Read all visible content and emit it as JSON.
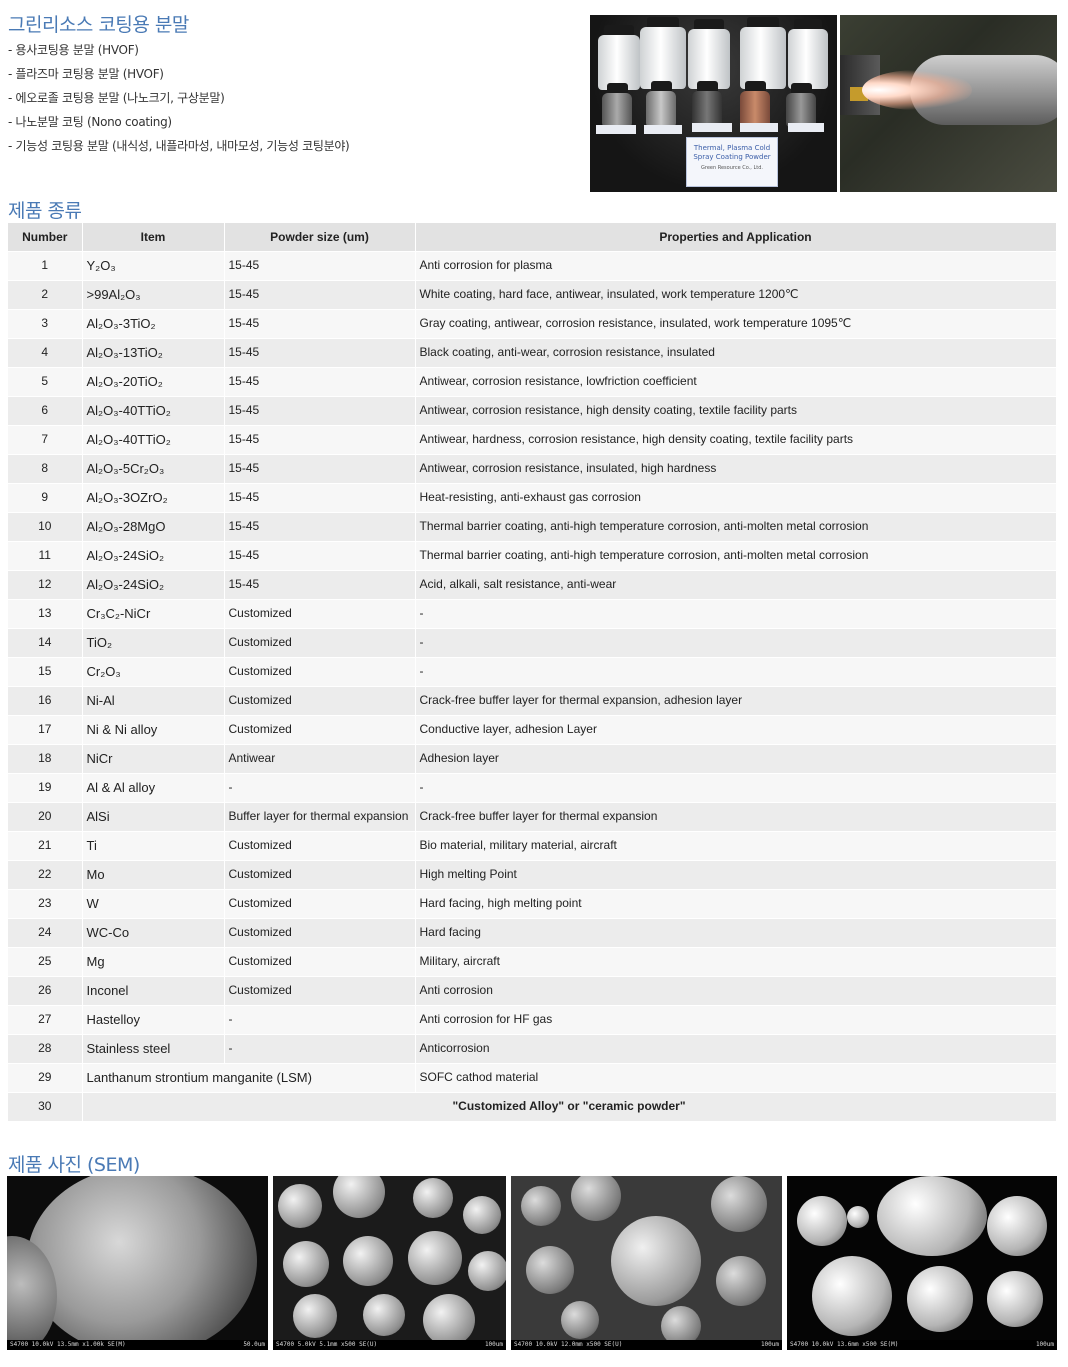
{
  "intro": {
    "title": "그린리소스 코팅용 분말",
    "items": [
      "- 용사코팅용 분말 (HVOF)",
      "- 플라즈마 코팅용 분말 (HVOF)",
      "- 에오로졸 코팅용 분말 (나노크기, 구상분말)",
      "- 나노분말 코팅 (Nono coating)",
      "- 기능성 코팅용 분말 (내식성, 내플라마성, 내마모성, 기능성 코팅분야)"
    ],
    "photo_label": "Thermal, Plasma Cold Spray Coating Powder",
    "photo_company": "Green Resource Co., Ltd."
  },
  "products": {
    "title": "제품 종류",
    "headers": [
      "Number",
      "Item",
      "Powder size (um)",
      "Properties and Application"
    ],
    "rows": [
      [
        "1",
        "Y₂O₃",
        "15-45",
        "Anti corrosion for plasma"
      ],
      [
        "2",
        ">99Al₂O₃",
        "15-45",
        "White coating, hard face, antiwear, insulated, work temperature 1200℃"
      ],
      [
        "3",
        "Al₂O₃-3TiO₂",
        "15-45",
        "Gray coating, antiwear, corrosion resistance, insulated, work temperature 1095℃"
      ],
      [
        "4",
        "Al₂O₃-13TiO₂",
        "15-45",
        "Black coating, anti-wear, corrosion resistance, insulated"
      ],
      [
        "5",
        "Al₂O₃-20TiO₂",
        "15-45",
        "Antiwear, corrosion resistance, lowfriction coefficient"
      ],
      [
        "6",
        "Al₂O₃-40TTiO₂",
        "15-45",
        "Antiwear, corrosion resistance, high density coating, textile facility parts"
      ],
      [
        "7",
        "Al₂O₃-40TTiO₂",
        "15-45",
        "Antiwear, hardness, corrosion resistance, high density coating, textile facility parts"
      ],
      [
        "8",
        "Al₂O₃-5Cr₂O₃",
        "15-45",
        "Antiwear, corrosion resistance, insulated, high hardness"
      ],
      [
        "9",
        "Al₂O₃-3OZrO₂",
        "15-45",
        "Heat-resisting, anti-exhaust gas corrosion"
      ],
      [
        "10",
        "Al₂O₃-28MgO",
        "15-45",
        "Thermal barrier coating, anti-high temperature corrosion, anti-molten metal corrosion"
      ],
      [
        "11",
        "Al₂O₃-24SiO₂",
        "15-45",
        "Thermal barrier coating, anti-high temperature corrosion, anti-molten metal corrosion"
      ],
      [
        "12",
        "Al₂O₃-24SiO₂",
        "15-45",
        "Acid, alkali, salt resistance, anti-wear"
      ],
      [
        "13",
        "Cr₃C₂-NiCr",
        "Customized",
        "-"
      ],
      [
        "14",
        "TiO₂",
        "Customized",
        "-"
      ],
      [
        "15",
        "Cr₂O₃",
        "Customized",
        "-"
      ],
      [
        "16",
        "Ni-Al",
        "Customized",
        "Crack-free buffer layer for thermal expansion, adhesion layer"
      ],
      [
        "17",
        "Ni & Ni alloy",
        "Customized",
        "Conductive layer, adhesion Layer"
      ],
      [
        "18",
        "NiCr",
        "Antiwear",
        "Adhesion layer"
      ],
      [
        "19",
        "Al & Al alloy",
        "-",
        "-"
      ],
      [
        "20",
        "AlSi",
        "Buffer layer for thermal expansion",
        "Crack-free buffer layer for thermal expansion"
      ],
      [
        "21",
        "Ti",
        "Customized",
        "Bio material, military material, aircraft"
      ],
      [
        "22",
        "Mo",
        "Customized",
        "High melting Point"
      ],
      [
        "23",
        "W",
        "Customized",
        "Hard facing, high melting point"
      ],
      [
        "24",
        "WC-Co",
        "Customized",
        "Hard facing"
      ],
      [
        "25",
        "Mg",
        "Customized",
        "Military, aircraft"
      ],
      [
        "26",
        "Inconel",
        "Customized",
        "Anti corrosion"
      ],
      [
        "27",
        "Hastelloy",
        "-",
        "Anti corrosion for HF gas"
      ],
      [
        "28",
        "Stainless steel",
        "-",
        "Anticorrosion"
      ]
    ],
    "row29": {
      "number": "29",
      "item": "Lanthanum strontium manganite (LSM)",
      "property": "SOFC cathod material"
    },
    "row30": {
      "number": "30",
      "text": "\"Customized Alloy\" or \"ceramic powder\""
    }
  },
  "sem": {
    "title": "제품 사진 (SEM)",
    "images": [
      {
        "caption": "S4700 10.0kV 13.5mm x1.00k SE(M)",
        "scale": "50.0um"
      },
      {
        "caption": "S4700 5.0kV 5.1mm x500 SE(U)",
        "scale": "100um"
      },
      {
        "caption": "S4700 10.0kV 12.0mm x500 SE(U)",
        "scale": "100um"
      },
      {
        "caption": "S4700 10.0kV 13.6mm x500 SE(M)",
        "scale": "100um"
      }
    ]
  }
}
